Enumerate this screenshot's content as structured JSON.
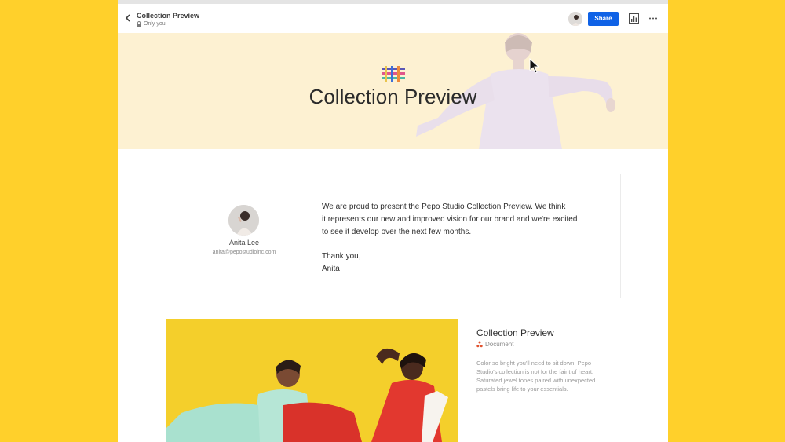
{
  "header": {
    "title": "Collection Preview",
    "privacy": "Only you",
    "share_label": "Share"
  },
  "hero": {
    "title": "Collection Preview"
  },
  "card": {
    "author_name": "Anita Lee",
    "author_email": "anita@pepostudioinc.com",
    "message_lines": [
      "We are proud to present the Pepo Studio Collection Preview. We think",
      "it represents our new and improved vision for our brand and we're excited",
      "to see it develop over the next few months."
    ],
    "sign_lines": [
      "Thank you,",
      "Anita"
    ]
  },
  "item": {
    "title": "Collection Preview",
    "type": "Document",
    "desc_lines": [
      "Color so bright you'll need to sit down. Pepo",
      "Studio's collection is not for the faint of heart.",
      "Saturated jewel tones paired with unexpected",
      "pastels bring life to your essentials."
    ]
  },
  "colors": {
    "background": "#ffd02b",
    "share_button": "#0f62e6",
    "hero_background": "#fdf1d2"
  },
  "icons": [
    "chevron-left-icon",
    "lock-icon",
    "stats-icon",
    "more-icon",
    "document-icon",
    "cursor-icon"
  ]
}
